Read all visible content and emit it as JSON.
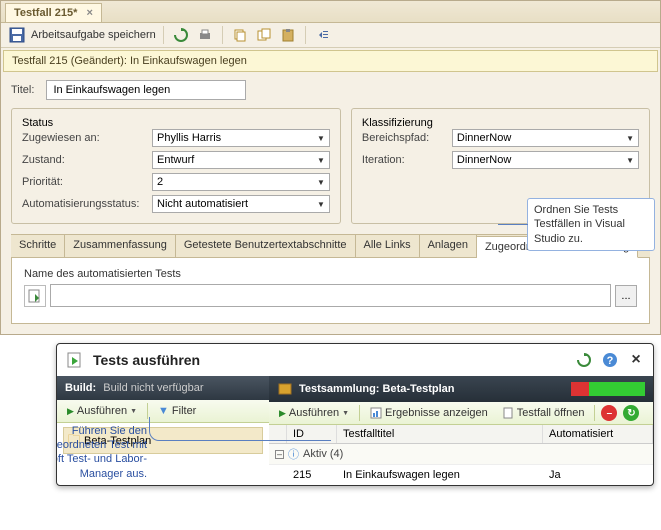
{
  "doc_tab": {
    "label": "Testfall 215*"
  },
  "toolbar": {
    "save_label": "Arbeitsaufgabe speichern"
  },
  "banner": "Testfall 215 (Geändert): In Einkaufswagen legen",
  "title": {
    "label": "Titel:",
    "value": "In Einkaufswagen legen"
  },
  "status": {
    "legend": "Status",
    "assigned_label": "Zugewiesen an:",
    "assigned_value": "Phyllis Harris",
    "state_label": "Zustand:",
    "state_value": "Entwurf",
    "priority_label": "Priorität:",
    "priority_value": "2",
    "auto_label": "Automatisierungsstatus:",
    "auto_value": "Nicht automatisiert"
  },
  "classification": {
    "legend": "Klassifizierung",
    "area_label": "Bereichspfad:",
    "area_value": "DinnerNow",
    "iteration_label": "Iteration:",
    "iteration_value": "DinnerNow"
  },
  "callout_top": "Ordnen Sie Tests Testfällen in Visual Studio zu.",
  "tabs": {
    "t0": "Schritte",
    "t1": "Zusammenfassung",
    "t2": "Getestete Benutzertextabschnitte",
    "t3": "Alle Links",
    "t4": "Anlagen",
    "t5": "Zugeordnete Automatisierung"
  },
  "assoc": {
    "label": "Name des automatisierten Tests",
    "value": "",
    "browse": "..."
  },
  "runner": {
    "title": "Tests ausführen",
    "build_label": "Build:",
    "build_value": "Build nicht verfügbar",
    "run_label": "Ausführen",
    "filter_label": "Filter",
    "suite_prefix": "Testsammlung:",
    "suite_name": "Beta-Testplan",
    "results_label": "Ergebnisse anzeigen",
    "open_label": "Testfall öffnen",
    "tree_item": "Beta-Testplan",
    "grid": {
      "col_id": "ID",
      "col_title": "Testfalltitel",
      "col_auto": "Automatisiert",
      "group_label": "Aktiv (4)",
      "row_id": "215",
      "row_title": "In Einkaufswagen legen",
      "row_auto": "Ja"
    }
  },
  "callout_bottom": "Führen Sie den zugeordneten Test mit Microsoft Test- und Labor-Manager aus."
}
